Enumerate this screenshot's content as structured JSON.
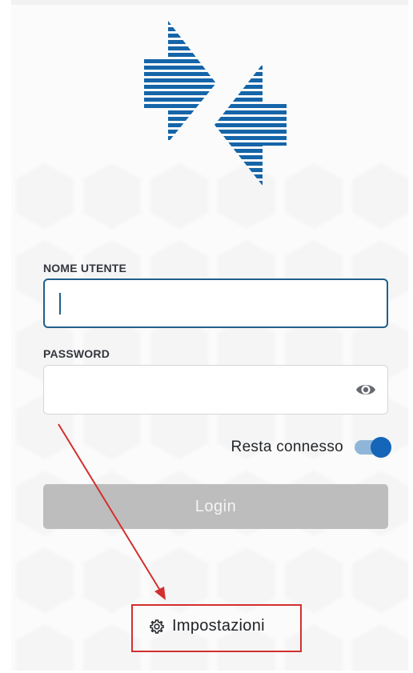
{
  "app": {
    "logo_icon": "double-arrow-stripes-logo",
    "brand_color": "#1565b8",
    "accent_color": "#1f5f8b"
  },
  "form": {
    "username": {
      "label": "NOME UTENTE",
      "value": "",
      "placeholder": ""
    },
    "password": {
      "label": "PASSWORD",
      "value": "",
      "placeholder": "",
      "reveal_icon": "eye-icon"
    },
    "remember": {
      "label": "Resta connesso",
      "enabled": true
    },
    "login_label": "Login",
    "login_disabled": true
  },
  "settings": {
    "label": "Impostazioni",
    "icon": "gear-icon"
  },
  "annotation": {
    "color": "#d32f2f"
  }
}
